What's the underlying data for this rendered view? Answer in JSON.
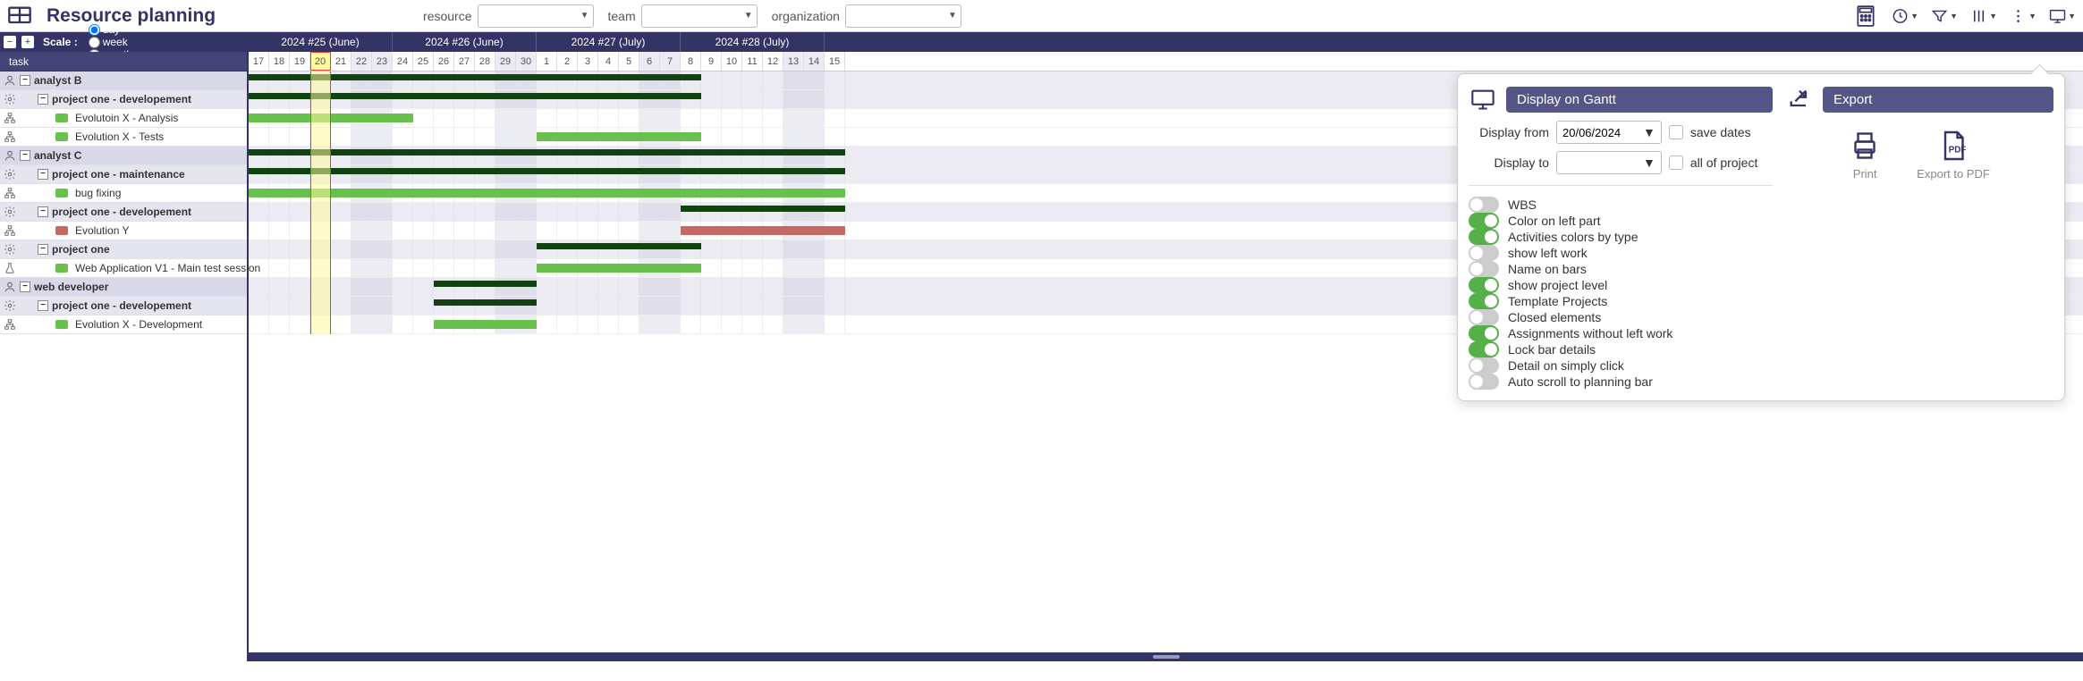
{
  "header": {
    "title": "Resource planning",
    "filters": [
      {
        "label": "resource"
      },
      {
        "label": "team"
      },
      {
        "label": "organization"
      }
    ]
  },
  "scale": {
    "label": "Scale :",
    "options": [
      "day",
      "week",
      "month"
    ],
    "selected": "day"
  },
  "task_header": "task",
  "timeline": {
    "weeks": [
      {
        "label": "2024 #25 (June)",
        "days": 7
      },
      {
        "label": "2024 #26 (June)",
        "days": 7
      },
      {
        "label": "2024 #27 (July)",
        "days": 7
      },
      {
        "label": "2024 #28 (July)",
        "days": 7
      }
    ],
    "days": [
      {
        "n": "17"
      },
      {
        "n": "18"
      },
      {
        "n": "19"
      },
      {
        "n": "20",
        "today": true
      },
      {
        "n": "21"
      },
      {
        "n": "22",
        "we": true
      },
      {
        "n": "23",
        "we": true
      },
      {
        "n": "24"
      },
      {
        "n": "25"
      },
      {
        "n": "26"
      },
      {
        "n": "27"
      },
      {
        "n": "28"
      },
      {
        "n": "29",
        "we": true
      },
      {
        "n": "30",
        "we": true
      },
      {
        "n": "1"
      },
      {
        "n": "2"
      },
      {
        "n": "3"
      },
      {
        "n": "4"
      },
      {
        "n": "5"
      },
      {
        "n": "6",
        "we": true
      },
      {
        "n": "7",
        "we": true
      },
      {
        "n": "8"
      },
      {
        "n": "9"
      },
      {
        "n": "10"
      },
      {
        "n": "11"
      },
      {
        "n": "12"
      },
      {
        "n": "13",
        "we": true
      },
      {
        "n": "14",
        "we": true
      },
      {
        "n": "15"
      }
    ],
    "today_index": 3
  },
  "tree": [
    {
      "type": "group",
      "icon": "user",
      "label": "analyst B"
    },
    {
      "type": "project",
      "icon": "gear",
      "label": "project one - developement"
    },
    {
      "type": "task",
      "icon": "org",
      "color": "#6ac04c",
      "label": "Evolutoin X - Analysis"
    },
    {
      "type": "task",
      "icon": "org",
      "color": "#6ac04c",
      "label": "Evolution X - Tests"
    },
    {
      "type": "group",
      "icon": "user",
      "label": "analyst C"
    },
    {
      "type": "project",
      "icon": "gear",
      "label": "project one - maintenance"
    },
    {
      "type": "task",
      "icon": "org",
      "color": "#6ac04c",
      "label": "bug fixing"
    },
    {
      "type": "project",
      "icon": "gear",
      "label": "project one - developement"
    },
    {
      "type": "task",
      "icon": "org",
      "color": "#c46a63",
      "label": "Evolution Y"
    },
    {
      "type": "project",
      "icon": "gear",
      "label": "project one"
    },
    {
      "type": "task",
      "icon": "flask",
      "color": "#6ac04c",
      "label": "Web Application V1 - Main test session"
    },
    {
      "type": "group",
      "icon": "user",
      "label": "web developer"
    },
    {
      "type": "project",
      "icon": "gear",
      "label": "project one - developement"
    },
    {
      "type": "task",
      "icon": "org",
      "color": "#6ac04c",
      "label": "Evolution X - Development"
    }
  ],
  "bars": [
    {
      "row": 0,
      "type": "summary",
      "start": 0,
      "len": 22
    },
    {
      "row": 1,
      "type": "summary",
      "start": 0,
      "len": 22
    },
    {
      "row": 2,
      "type": "green",
      "start": 0,
      "len": 8
    },
    {
      "row": 3,
      "type": "green",
      "start": 14,
      "len": 8
    },
    {
      "row": 4,
      "type": "summary",
      "start": 0,
      "len": 29
    },
    {
      "row": 5,
      "type": "summary",
      "start": 0,
      "len": 29
    },
    {
      "row": 6,
      "type": "green",
      "start": 0,
      "len": 29
    },
    {
      "row": 7,
      "type": "summary",
      "start": 21,
      "len": 8
    },
    {
      "row": 8,
      "type": "red",
      "start": 21,
      "len": 8
    },
    {
      "row": 9,
      "type": "summary",
      "start": 14,
      "len": 8
    },
    {
      "row": 10,
      "type": "green",
      "start": 14,
      "len": 8
    },
    {
      "row": 11,
      "type": "summary",
      "start": 9,
      "len": 5
    },
    {
      "row": 12,
      "type": "summary",
      "start": 9,
      "len": 5
    },
    {
      "row": 13,
      "type": "green",
      "start": 9,
      "len": 5
    }
  ],
  "popover": {
    "gantt_header": "Display on Gantt",
    "export_header": "Export",
    "display_from_label": "Display from",
    "display_from_value": "20/06/2024",
    "display_to_label": "Display to",
    "save_dates": "save dates",
    "all_of_project": "all of project",
    "toggles": [
      {
        "label": "WBS",
        "on": false
      },
      {
        "label": "Color on left part",
        "on": true
      },
      {
        "label": "Activities colors by type",
        "on": true
      },
      {
        "label": "show left work",
        "on": false
      },
      {
        "label": "Name on bars",
        "on": false
      },
      {
        "label": "show project level",
        "on": true
      },
      {
        "label": "Template Projects",
        "on": true
      },
      {
        "label": "Closed elements",
        "on": false
      },
      {
        "label": "Assignments without left work",
        "on": true
      },
      {
        "label": "Lock bar details",
        "on": true
      },
      {
        "label": "Detail on simply click",
        "on": false
      },
      {
        "label": "Auto scroll to planning bar",
        "on": false
      }
    ],
    "print_label": "Print",
    "pdf_label": "Export to PDF"
  }
}
